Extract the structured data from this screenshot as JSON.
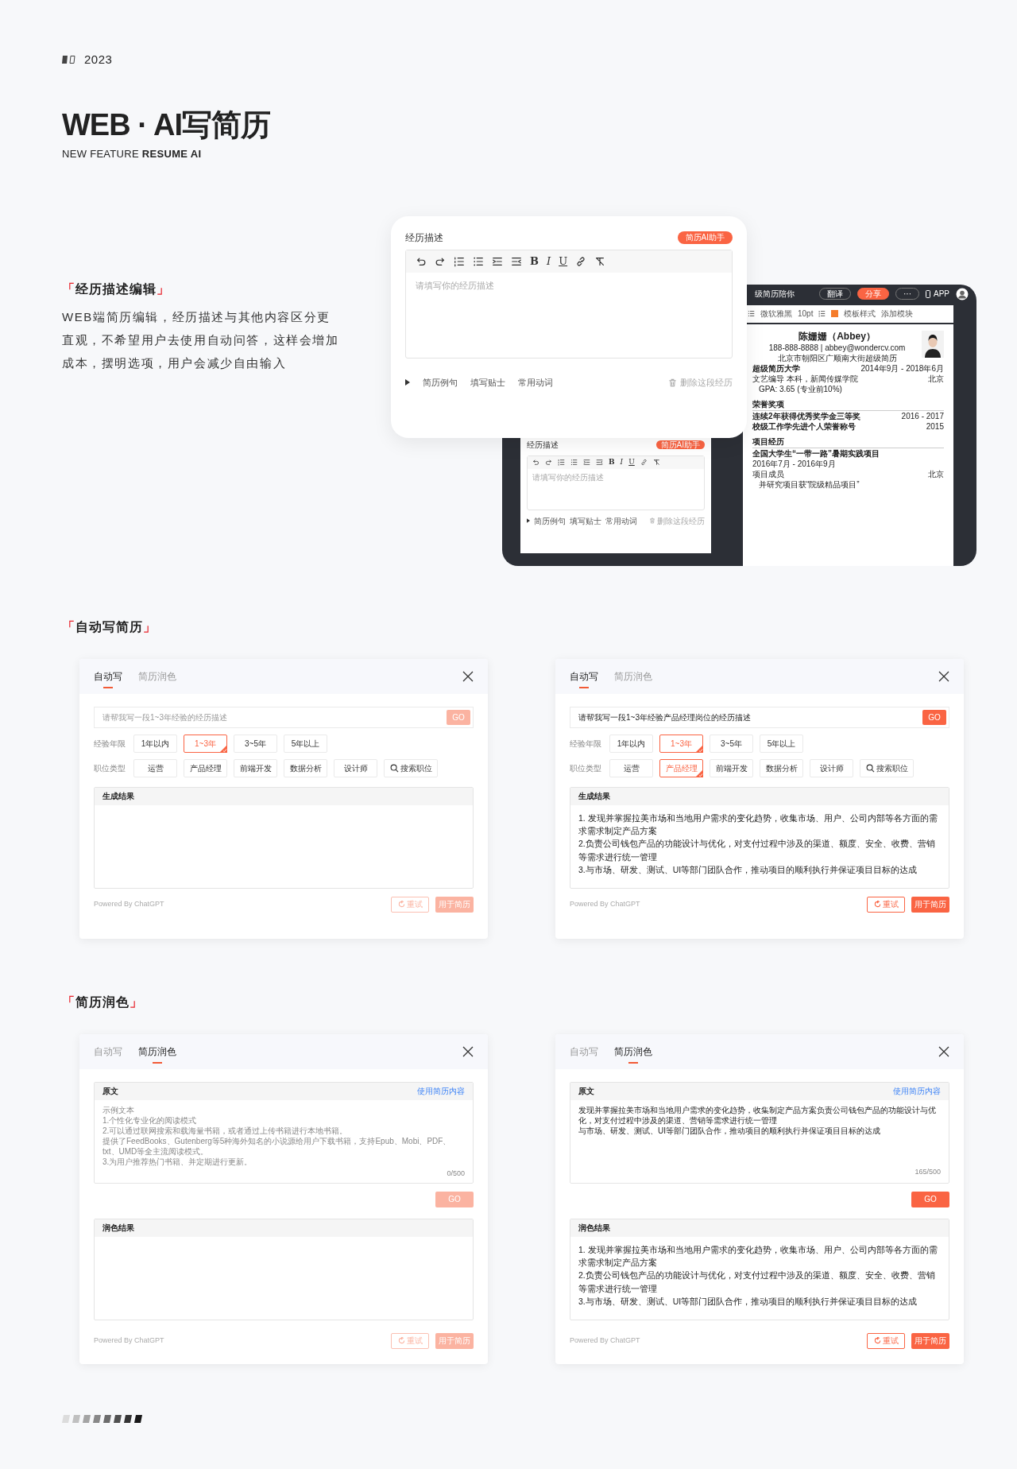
{
  "header": {
    "year": "2023",
    "title": "WEB · AI写简历",
    "subtitle": "NEW FEATURE **RESUME AI**"
  },
  "intro": {
    "heading": {
      "open": "「",
      "text": "经历描述编辑",
      "close": "」"
    },
    "paragraph": "WEB端简历编辑，经历描述与其他内容区分更直观，不希望用户去使用自动问答，这样会增加成本，摆明选项，用户会减少自由输入"
  },
  "editor_card": {
    "title": "经历描述",
    "assistant_button": "简历AI助手",
    "toolbar_letters": [
      "B",
      "I",
      "U"
    ],
    "placeholder": "请填写你的经历描述",
    "links": [
      "简历例句",
      "填写贴士",
      "常用动词"
    ],
    "delete": "删除这段经历"
  },
  "app_preview": {
    "app_title": "级简历陪你",
    "top_buttons": [
      {
        "label": "翻译",
        "primary": false
      },
      {
        "label": "分享",
        "primary": true
      },
      {
        "label": "···",
        "primary": false
      }
    ],
    "app_link": "APP",
    "toolbar": [
      "微软雅黑",
      "10pt",
      "模板样式",
      "添加模块"
    ],
    "editor_copy": {
      "title": "经历描述",
      "assistant_button": "简历AI助手",
      "toolbar_letters": [
        "B",
        "I",
        "U"
      ],
      "placeholder": "请填写你的经历描述",
      "links": [
        "简历例句",
        "填写贴士",
        "常用动词"
      ],
      "delete": "删除这段经历"
    },
    "resume": {
      "name": "陈姗姗（Abbey）",
      "contact": "188-888-8888 | abbey@wondercv.com",
      "address": "北京市朝阳区广顺南大街超级简历",
      "sections": [
        {
          "entries": [
            {
              "org": "超级简历大学",
              "date": "2014年9月 - 2018年6月",
              "sub": "文艺编导 本科，新闻传媒学院",
              "place": "北京",
              "bullets": [
                "GPA: 3.65 (专业前10%)"
              ]
            }
          ]
        },
        {
          "title": "荣誉奖项",
          "entries": [
            {
              "org": "连续2年获得优秀奖学金三等奖",
              "date": "2016 - 2017"
            },
            {
              "org": "校级工作学先进个人荣誉称号",
              "date": "2015"
            }
          ]
        },
        {
          "title": "项目经历",
          "entries": [
            {
              "org": "全国大学生“一带一路”暑期实践项目",
              "date": "2016年7月 - 2016年9月",
              "sub": "项目成员",
              "place": "北京",
              "bullets": [
                "并研究项目获“院级精品项目”"
              ]
            }
          ]
        }
      ]
    }
  },
  "autowrite": {
    "heading": {
      "open": "「",
      "text": "自动写简历",
      "close": "」"
    },
    "panels": [
      {
        "tabs": [
          {
            "label": "自动写",
            "selected": true
          },
          {
            "label": "简历润色",
            "selected": false
          }
        ],
        "prompt": {
          "placeholder": "请帮我写一段1~3年经验的经历描述"
        },
        "go": "GO",
        "active": false,
        "filters": [
          {
            "label": "经验年限",
            "options": [
              {
                "label": "1年以内",
                "selected": false
              },
              {
                "label": "1~3年",
                "selected": true
              },
              {
                "label": "3~5年",
                "selected": false
              },
              {
                "label": "5年以上",
                "selected": false
              }
            ]
          },
          {
            "label": "职位类型",
            "options": [
              {
                "label": "运营",
                "selected": false
              },
              {
                "label": "产品经理",
                "selected": false
              },
              {
                "label": "前端开发",
                "selected": false
              },
              {
                "label": "数据分析",
                "selected": false
              },
              {
                "label": "设计师",
                "selected": false
              },
              {
                "label": "搜索职位",
                "selected": false,
                "kind": "search"
              }
            ]
          }
        ],
        "result": {
          "title": "生成结果"
        },
        "powered": "Powered By ChatGPT",
        "retry": "重试",
        "apply": "用于简历"
      },
      {
        "tabs": [
          {
            "label": "自动写",
            "selected": true
          },
          {
            "label": "简历润色",
            "selected": false
          }
        ],
        "prompt": {
          "value": "请帮我写一段1~3年经验产品经理岗位的经历描述"
        },
        "go": "GO",
        "active": true,
        "filters": [
          {
            "label": "经验年限",
            "options": [
              {
                "label": "1年以内",
                "selected": false
              },
              {
                "label": "1~3年",
                "selected": true
              },
              {
                "label": "3~5年",
                "selected": false
              },
              {
                "label": "5年以上",
                "selected": false
              }
            ]
          },
          {
            "label": "职位类型",
            "options": [
              {
                "label": "运营",
                "selected": false
              },
              {
                "label": "产品经理",
                "selected": true
              },
              {
                "label": "前端开发",
                "selected": false
              },
              {
                "label": "数据分析",
                "selected": false
              },
              {
                "label": "设计师",
                "selected": false
              },
              {
                "label": "搜索职位",
                "selected": false,
                "kind": "search"
              }
            ]
          }
        ],
        "result": {
          "title": "生成结果",
          "lines": [
            "1. 发现并掌握拉美市场和当地用户需求的变化趋势，收集市场、用户、公司内部等各方面的需求需求制定产品方案",
            "2.负责公司钱包产品的功能设计与优化，对支付过程中涉及的渠道、额度、安全、收费、营销等需求进行统一管理",
            "3.与市场、研发、测试、UI等部门团队合作，推动项目的顺利执行并保证项目目标的达成"
          ]
        },
        "powered": "Powered By ChatGPT",
        "retry": "重试",
        "apply": "用于简历"
      }
    ]
  },
  "polish": {
    "heading": {
      "open": "「",
      "text": "简历润色",
      "close": "」"
    },
    "panels": [
      {
        "tabs": [
          {
            "label": "自动写",
            "selected": false
          },
          {
            "label": "简历润色",
            "selected": true
          }
        ],
        "source": {
          "title": "原文",
          "link": "使用简历内容",
          "placeholder": true,
          "lines": [
            "示例文本",
            "1.个性化专业化的阅读模式",
            "2.可以通过联网搜索和载海量书籍，或者通过上传书籍进行本地书籍。",
            "提供了FeedBooks、Gutenberg等5种海外知名的小说源给用户下载书籍，支持Epub、Mobi、PDF、txt、UMD等全主流阅读模式。",
            "3.为用户推荐热门书籍、并定期进行更新。"
          ],
          "counter": "0/500"
        },
        "go": "GO",
        "active": false,
        "result": {
          "title": "润色结果"
        },
        "powered": "Powered By ChatGPT",
        "retry": "重试",
        "apply": "用于简历"
      },
      {
        "tabs": [
          {
            "label": "自动写",
            "selected": false
          },
          {
            "label": "简历润色",
            "selected": true
          }
        ],
        "source": {
          "title": "原文",
          "link": "使用简历内容",
          "placeholder": false,
          "lines": [
            "发现并掌握拉美市场和当地用户需求的变化趋势，收集制定产品方案负责公司钱包产品的功能设计与优化，对支付过程中涉及的渠道、营销等需求进行统一管理",
            "与市场、研发、测试、UI等部门团队合作，推动项目的顺利执行并保证项目目标的达成"
          ],
          "counter": "165/500"
        },
        "go": "GO",
        "active": true,
        "result": {
          "title": "润色结果",
          "lines": [
            "1. 发现并掌握拉美市场和当地用户需求的变化趋势，收集市场、用户、公司内部等各方面的需求需求制定产品方案",
            "2.负责公司钱包产品的功能设计与优化，对支付过程中涉及的渠道、额度、安全、收费、营销等需求进行统一管理",
            "3.与市场、研发、测试、UI等部门团队合作，推动项目的顺利执行并保证项目目标的达成"
          ]
        },
        "powered": "Powered By ChatGPT",
        "retry": "重试",
        "apply": "用于简历"
      }
    ]
  }
}
